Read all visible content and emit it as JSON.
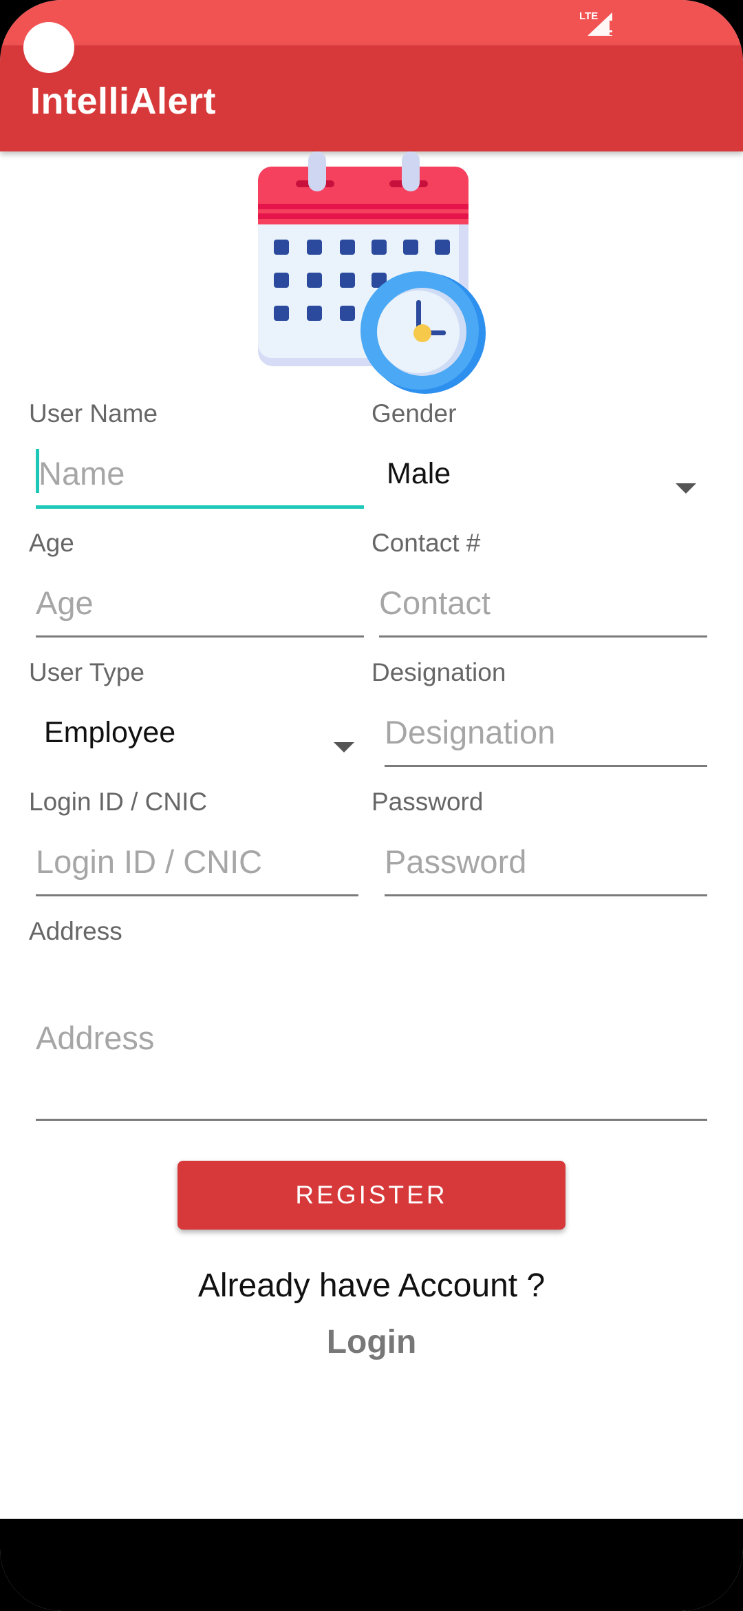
{
  "status_bar": {
    "network_label": "LTE"
  },
  "app_bar": {
    "title": "IntelliAlert"
  },
  "form": {
    "user_name": {
      "label": "User Name",
      "placeholder": "Name"
    },
    "gender": {
      "label": "Gender",
      "selected": "Male"
    },
    "age": {
      "label": "Age",
      "placeholder": "Age"
    },
    "contact": {
      "label": "Contact #",
      "placeholder": "Contact"
    },
    "user_type": {
      "label": "User Type",
      "selected": "Employee"
    },
    "designation": {
      "label": "Designation",
      "placeholder": "Designation"
    },
    "login_id": {
      "label": "Login ID / CNIC",
      "placeholder": "Login ID / CNIC"
    },
    "password": {
      "label": "Password",
      "placeholder": "Password"
    },
    "address": {
      "label": "Address",
      "placeholder": "Address"
    }
  },
  "actions": {
    "register_label": "REGISTER",
    "already_text": "Already have Account ?",
    "login_label": "Login"
  },
  "colors": {
    "status_bar": "#f15353",
    "app_bar": "#d7393a",
    "accent_focus": "#1ec8b8",
    "button": "#d7393a"
  },
  "icons": {
    "illustration": "calendar-clock-icon",
    "dropdown": "chevron-down-icon",
    "signal": "cell-signal-icon"
  }
}
